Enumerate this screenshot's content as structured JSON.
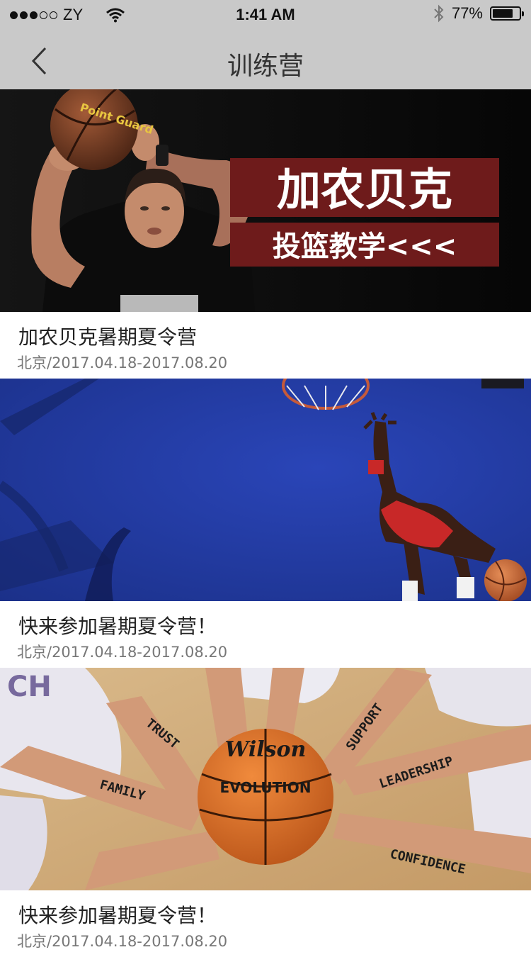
{
  "status_bar": {
    "carrier": "ZY",
    "time": "1:41 AM",
    "battery": "77%",
    "battery_level": 0.77
  },
  "nav": {
    "title": "训练营",
    "back_icon": "chevron-left-icon"
  },
  "camps": [
    {
      "name": "加农贝克暑期夏令营",
      "meta": "北京/2017.04.18-2017.08.20",
      "banner_line1": "加农贝克",
      "banner_line2": "投篮教学<<<",
      "ball_brand": "Point Guard"
    },
    {
      "name": "快来参加暑期夏令营！",
      "meta": "北京/2017.04.18-2017.08.20"
    },
    {
      "name": "快来参加暑期夏令营！",
      "meta": "北京/2017.04.18-2017.08.20",
      "ball_brand": "Wilson",
      "ball_model": "EVOLUTION",
      "arm_words": [
        "TRUST",
        "FAMILY",
        "SUPPORT",
        "LEADERSHIP",
        "CONFIDENCE"
      ]
    }
  ]
}
